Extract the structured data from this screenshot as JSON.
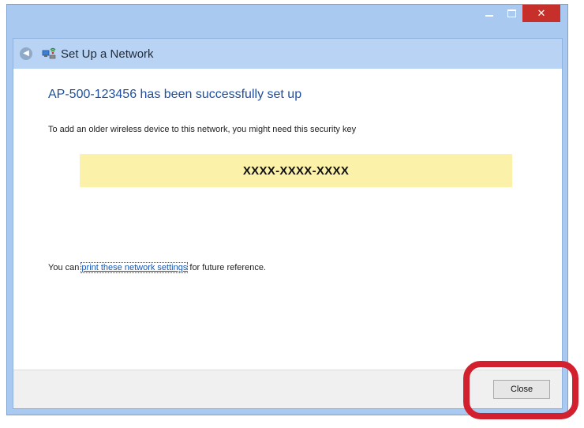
{
  "window": {
    "title": "Set Up a Network",
    "controls": {
      "close_glyph": "✕",
      "back_glyph": "◀"
    }
  },
  "main": {
    "heading": "AP-500-123456 has been successfully set up",
    "instruction": "To add an older wireless device to this network, you might need this security key",
    "security_key": "XXXX-XXXX-XXXX",
    "print_prefix": "You can ",
    "print_link": "print these network settings",
    "print_suffix": " for future reference."
  },
  "footer": {
    "close_label": "Close"
  },
  "icons": {
    "back": "back-arrow-icon",
    "network": "network-setup-icon"
  },
  "colors": {
    "key_highlight": "#fbf1a9",
    "heading": "#1f4f9e",
    "close_control": "#c7302a",
    "annotation_ring": "#d2202f"
  }
}
